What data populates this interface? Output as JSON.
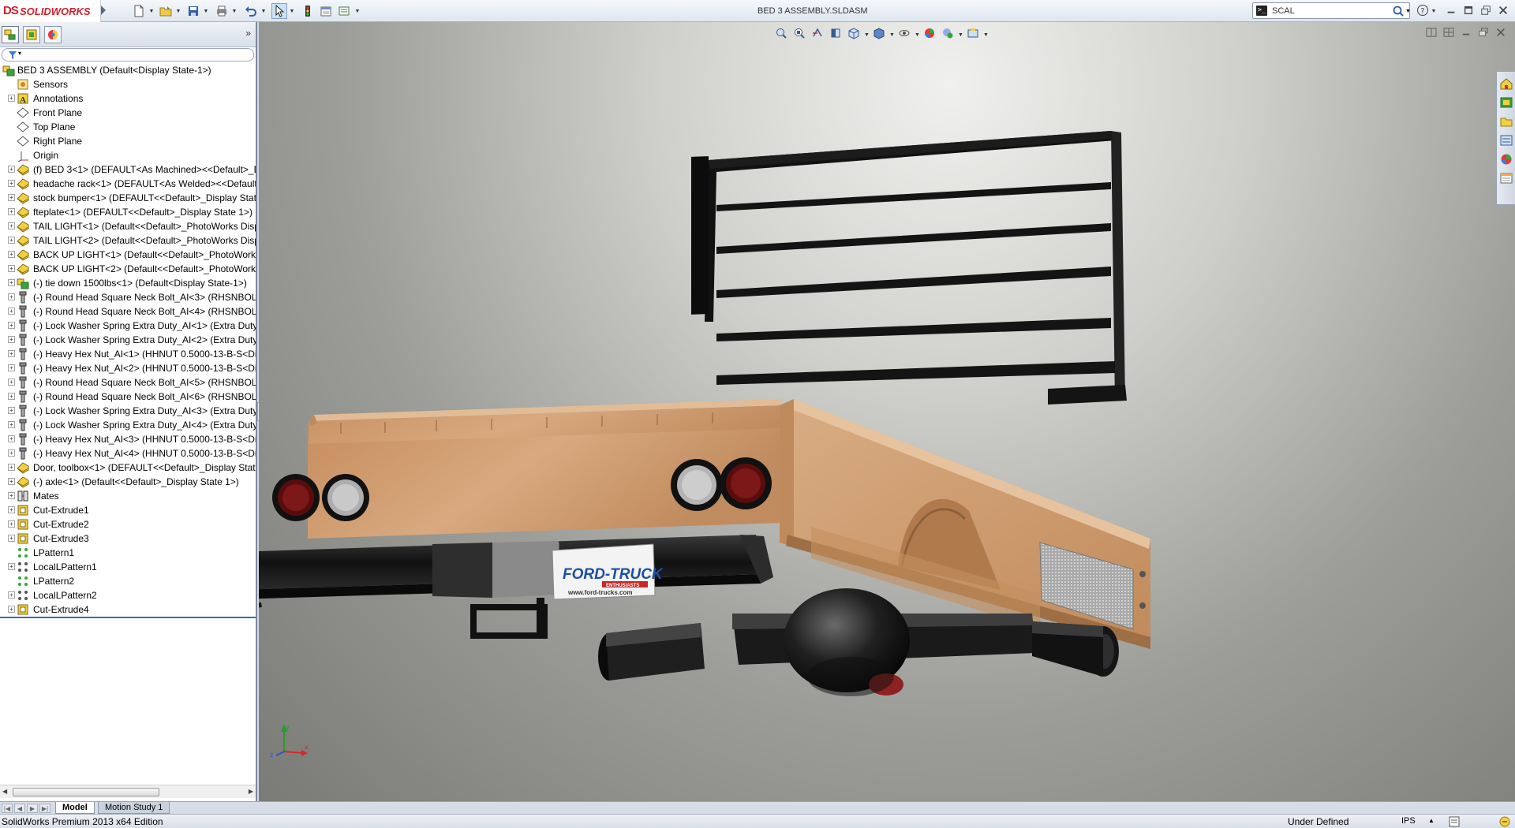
{
  "app": {
    "brand": "SOLIDWORKS",
    "brand_mark": "DS"
  },
  "window": {
    "title": "BED 3 ASSEMBLY.SLDASM"
  },
  "search": {
    "value": "SCAL",
    "term_icon": ">_"
  },
  "panel": {
    "tabs": [
      "featuremanager-design-tree",
      "configuration-manager",
      "display-manager"
    ],
    "collapse_glyph": "»",
    "filter_glyph": "▾"
  },
  "tree": {
    "items": [
      {
        "label": "BED 3 ASSEMBLY  (Default<Display State-1>)",
        "icon": "assembly-icon",
        "indent": 0,
        "expander": ""
      },
      {
        "label": "Sensors",
        "icon": "sensors-icon",
        "indent": 1,
        "expander": ""
      },
      {
        "label": "Annotations",
        "icon": "annotations-icon",
        "indent": 1,
        "expander": "+"
      },
      {
        "label": "Front Plane",
        "icon": "plane-icon",
        "indent": 1,
        "expander": ""
      },
      {
        "label": "Top Plane",
        "icon": "plane-icon",
        "indent": 1,
        "expander": ""
      },
      {
        "label": "Right Plane",
        "icon": "plane-icon",
        "indent": 1,
        "expander": ""
      },
      {
        "label": "Origin",
        "icon": "origin-icon",
        "indent": 1,
        "expander": ""
      },
      {
        "label": "(f) BED 3<1> (DEFAULT<As Machined><<Default>_D",
        "icon": "part-icon",
        "indent": 1,
        "expander": "+"
      },
      {
        "label": "headache rack<1> (DEFAULT<As Welded><<Default",
        "icon": "part-icon",
        "indent": 1,
        "expander": "+"
      },
      {
        "label": "stock bumper<1> (DEFAULT<<Default>_Display State",
        "icon": "part-icon",
        "indent": 1,
        "expander": "+"
      },
      {
        "label": "fteplate<1> (DEFAULT<<Default>_Display State 1>)",
        "icon": "part-icon",
        "indent": 1,
        "expander": "+"
      },
      {
        "label": "TAIL LIGHT<1> (Default<<Default>_PhotoWorks Disp",
        "icon": "part-icon",
        "indent": 1,
        "expander": "+"
      },
      {
        "label": "TAIL LIGHT<2> (Default<<Default>_PhotoWorks Disp",
        "icon": "part-icon",
        "indent": 1,
        "expander": "+"
      },
      {
        "label": "BACK UP LIGHT<1> (Default<<Default>_PhotoWorks",
        "icon": "part-icon",
        "indent": 1,
        "expander": "+"
      },
      {
        "label": "BACK UP LIGHT<2> (Default<<Default>_PhotoWorks",
        "icon": "part-icon",
        "indent": 1,
        "expander": "+"
      },
      {
        "label": "(-) tie down 1500lbs<1> (Default<Display State-1>)",
        "icon": "subassembly-icon",
        "indent": 1,
        "expander": "+"
      },
      {
        "label": "(-) Round Head Square Neck Bolt_AI<3> (RHSNBOLT",
        "icon": "toolbox-part-icon",
        "indent": 1,
        "expander": "+"
      },
      {
        "label": "(-) Round Head Square Neck Bolt_AI<4> (RHSNBOLT",
        "icon": "toolbox-part-icon",
        "indent": 1,
        "expander": "+"
      },
      {
        "label": "(-) Lock Washer Spring Extra Duty_AI<1> (Extra Duty L",
        "icon": "toolbox-part-icon",
        "indent": 1,
        "expander": "+"
      },
      {
        "label": "(-) Lock Washer Spring Extra Duty_AI<2> (Extra Duty L",
        "icon": "toolbox-part-icon",
        "indent": 1,
        "expander": "+"
      },
      {
        "label": "(-) Heavy Hex Nut_AI<1> (HHNUT 0.5000-13-B-S<Dis",
        "icon": "toolbox-part-icon",
        "indent": 1,
        "expander": "+"
      },
      {
        "label": "(-) Heavy Hex Nut_AI<2> (HHNUT 0.5000-13-B-S<Dis",
        "icon": "toolbox-part-icon",
        "indent": 1,
        "expander": "+"
      },
      {
        "label": "(-) Round Head Square Neck Bolt_AI<5> (RHSNBOLT",
        "icon": "toolbox-part-icon",
        "indent": 1,
        "expander": "+"
      },
      {
        "label": "(-) Round Head Square Neck Bolt_AI<6> (RHSNBOLT",
        "icon": "toolbox-part-icon",
        "indent": 1,
        "expander": "+"
      },
      {
        "label": "(-) Lock Washer Spring Extra Duty_AI<3> (Extra Duty L",
        "icon": "toolbox-part-icon",
        "indent": 1,
        "expander": "+"
      },
      {
        "label": "(-) Lock Washer Spring Extra Duty_AI<4> (Extra Duty L",
        "icon": "toolbox-part-icon",
        "indent": 1,
        "expander": "+"
      },
      {
        "label": "(-) Heavy Hex Nut_AI<3> (HHNUT 0.5000-13-B-S<Dis",
        "icon": "toolbox-part-icon",
        "indent": 1,
        "expander": "+"
      },
      {
        "label": "(-) Heavy Hex Nut_AI<4> (HHNUT 0.5000-13-B-S<Dis",
        "icon": "toolbox-part-icon",
        "indent": 1,
        "expander": "+"
      },
      {
        "label": "Door, toolbox<1> (DEFAULT<<Default>_Display State",
        "icon": "part-icon",
        "indent": 1,
        "expander": "+"
      },
      {
        "label": "(-) axle<1> (Default<<Default>_Display State 1>)",
        "icon": "part-icon",
        "indent": 1,
        "expander": "+"
      },
      {
        "label": "Mates",
        "icon": "mates-icon",
        "indent": 1,
        "expander": "+"
      },
      {
        "label": "Cut-Extrude1",
        "icon": "cut-extrude-icon",
        "indent": 1,
        "expander": "+"
      },
      {
        "label": "Cut-Extrude2",
        "icon": "cut-extrude-icon",
        "indent": 1,
        "expander": "+"
      },
      {
        "label": "Cut-Extrude3",
        "icon": "cut-extrude-icon",
        "indent": 1,
        "expander": "+"
      },
      {
        "label": "LPattern1",
        "icon": "linear-pattern-icon",
        "indent": 1,
        "expander": ""
      },
      {
        "label": "LocalLPattern1",
        "icon": "local-pattern-icon",
        "indent": 1,
        "expander": "+"
      },
      {
        "label": "LPattern2",
        "icon": "linear-pattern-icon",
        "indent": 1,
        "expander": ""
      },
      {
        "label": "LocalLPattern2",
        "icon": "local-pattern-icon",
        "indent": 1,
        "expander": "+"
      },
      {
        "label": "Cut-Extrude4",
        "icon": "cut-extrude-icon",
        "indent": 1,
        "expander": "+"
      }
    ]
  },
  "viewport": {
    "plate_line1": "FORD-TRUCK",
    "plate_line2": "ENTHUSIASTS",
    "plate_line3": "www.ford-trucks.com",
    "triad": {
      "x": "x",
      "y": "y",
      "z": "z"
    }
  },
  "bottom_tabs": [
    {
      "label": "Model",
      "active": true
    },
    {
      "label": "Motion Study 1",
      "active": false
    }
  ],
  "status": {
    "edition": "SolidWorks Premium 2013 x64 Edition",
    "definition": "Under Defined",
    "units": "IPS"
  },
  "colors": {
    "brand_red": "#d2202a",
    "wood": "#d2a075",
    "rack": "#141414",
    "tree_end_line": "#2f6fb9"
  }
}
